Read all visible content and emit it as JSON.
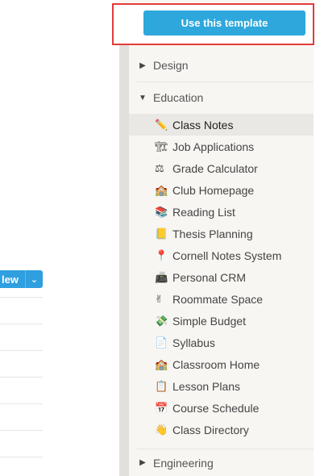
{
  "left": {
    "new_button_label": "lew",
    "new_button_caret": "⌄"
  },
  "panel": {
    "use_template_label": "Use this template",
    "sections": [
      {
        "label": "Design",
        "arrow": "▶"
      },
      {
        "label": "Education",
        "arrow": "▼"
      },
      {
        "label": "Engineering",
        "arrow": "▶"
      }
    ],
    "items": [
      {
        "label": "Class Notes",
        "icon": "✏️"
      },
      {
        "label": "Job Applications",
        "icon": "🏗"
      },
      {
        "label": "Grade Calculator",
        "icon": "⚖"
      },
      {
        "label": "Club Homepage",
        "icon": "🏫"
      },
      {
        "label": "Reading List",
        "icon": "📚"
      },
      {
        "label": "Thesis Planning",
        "icon": "📒"
      },
      {
        "label": "Cornell Notes System",
        "icon": "📍"
      },
      {
        "label": "Personal CRM",
        "icon": "📠"
      },
      {
        "label": "Roommate Space",
        "icon": "✌"
      },
      {
        "label": "Simple Budget",
        "icon": "💸"
      },
      {
        "label": "Syllabus",
        "icon": "📄"
      },
      {
        "label": "Classroom Home",
        "icon": "🏫"
      },
      {
        "label": "Lesson Plans",
        "icon": "📋"
      },
      {
        "label": "Course Schedule",
        "icon": "📅"
      },
      {
        "label": "Class Directory",
        "icon": "👋"
      }
    ]
  }
}
